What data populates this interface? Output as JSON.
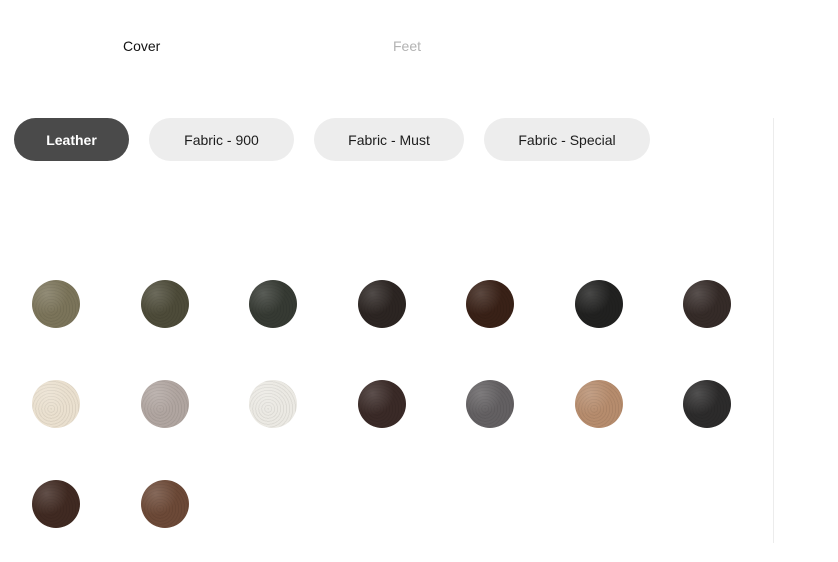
{
  "tabs": {
    "cover": "Cover",
    "feet": "Feet"
  },
  "categories": [
    {
      "label": "Leather",
      "active": true
    },
    {
      "label": "Fabric - 900",
      "active": false
    },
    {
      "label": "Fabric - Must",
      "active": false
    },
    {
      "label": "Fabric - Special",
      "active": false
    }
  ],
  "swatches": [
    {
      "color": "#7b745a"
    },
    {
      "color": "#4d4b39"
    },
    {
      "color": "#363a33"
    },
    {
      "color": "#2c2522"
    },
    {
      "color": "#392117"
    },
    {
      "color": "#212120"
    },
    {
      "color": "#352b28"
    },
    {
      "color": "#eae0cf"
    },
    {
      "color": "#b0a5a0"
    },
    {
      "color": "#ebe9e3"
    },
    {
      "color": "#3a2a27"
    },
    {
      "color": "#636062"
    },
    {
      "color": "#b68c6d"
    },
    {
      "color": "#2c2b2b"
    },
    {
      "color": "#402a22"
    },
    {
      "color": "#6c4937"
    }
  ]
}
